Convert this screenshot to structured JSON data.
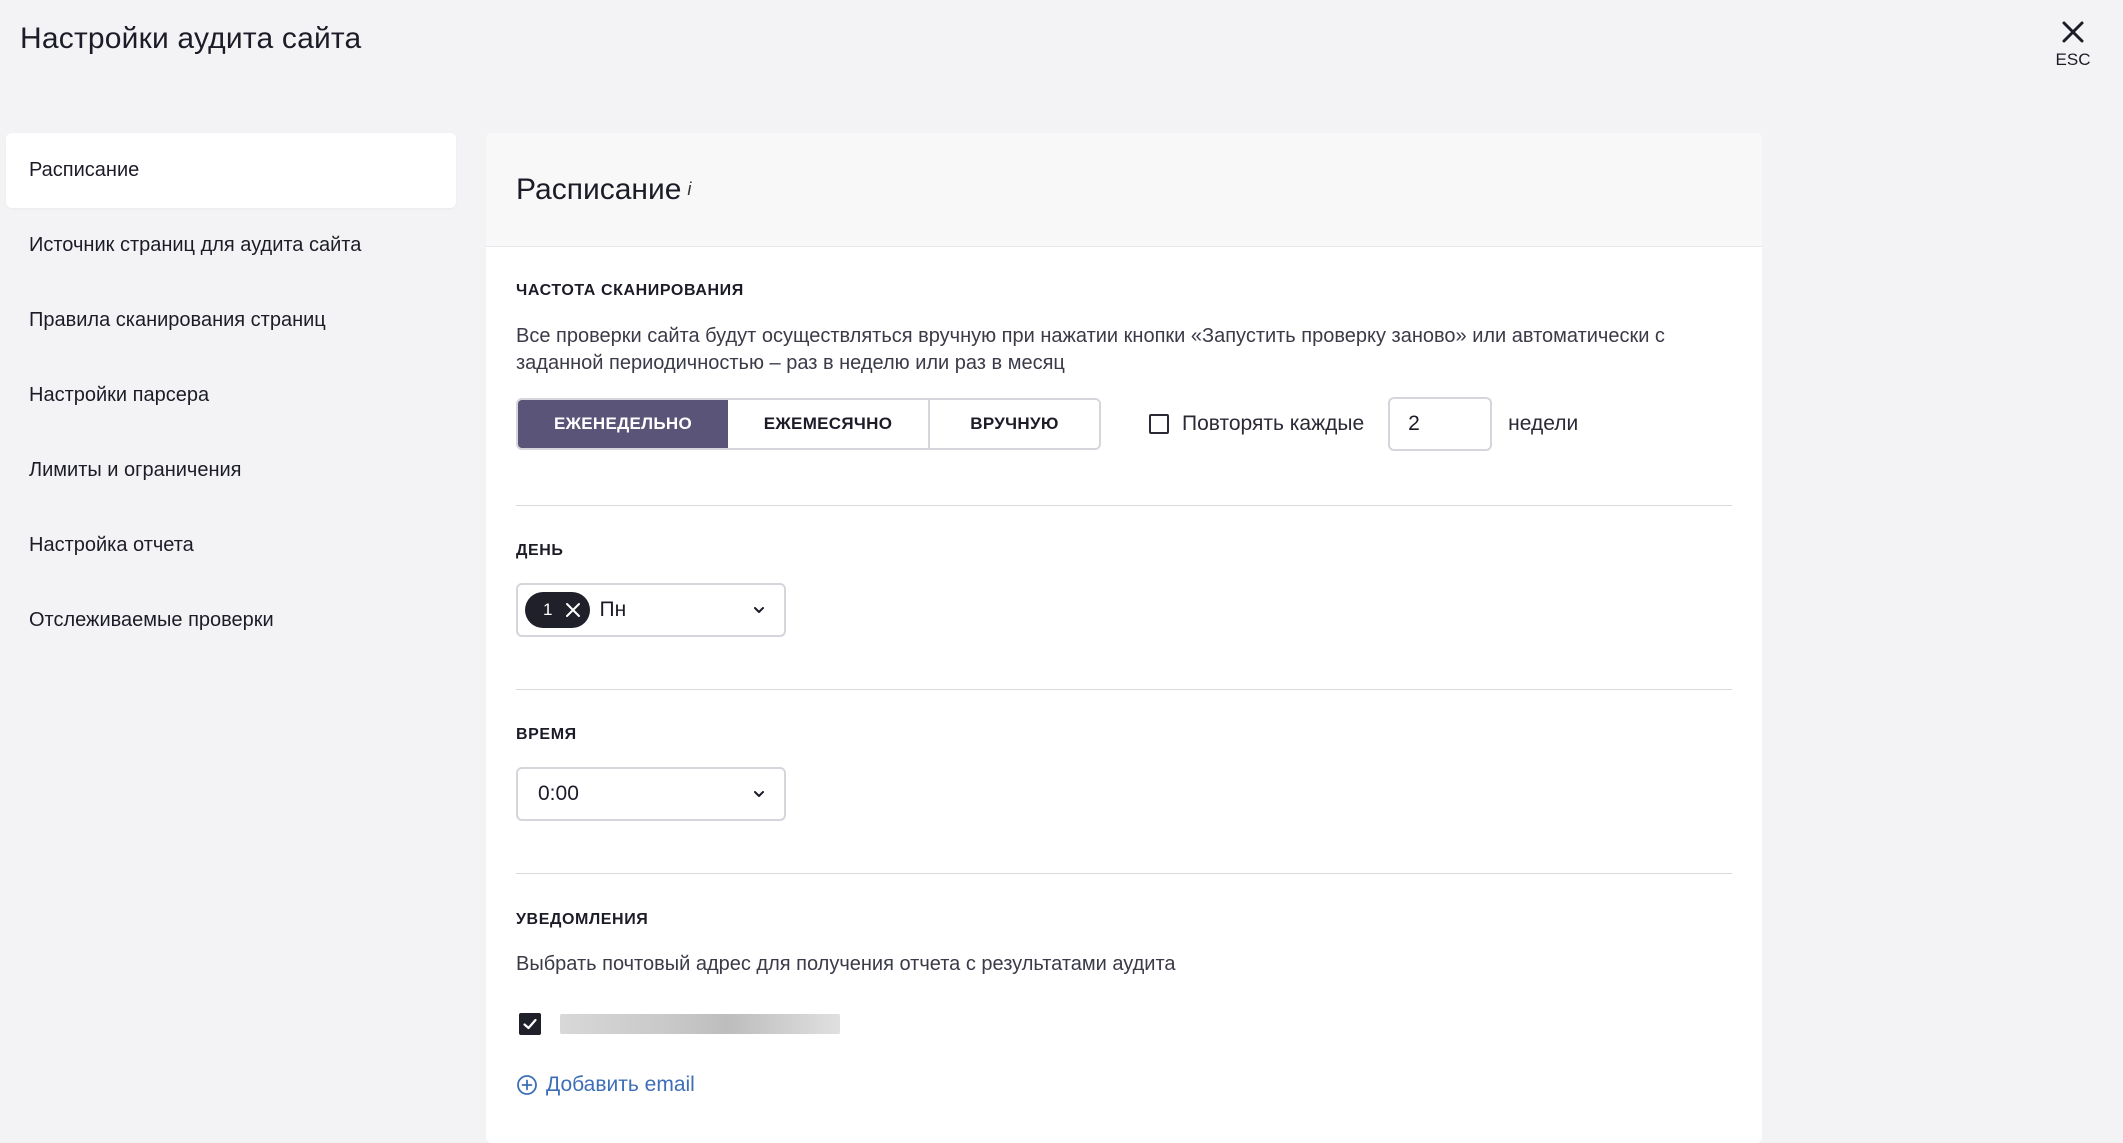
{
  "header": {
    "title": "Настройки аудита сайта",
    "close_label": "ESC"
  },
  "sidebar": {
    "items": [
      {
        "label": "Расписание",
        "active": true
      },
      {
        "label": "Источник страниц для аудита сайта"
      },
      {
        "label": "Правила сканирования страниц"
      },
      {
        "label": "Настройки парсера"
      },
      {
        "label": "Лимиты и ограничения"
      },
      {
        "label": "Настройка отчета"
      },
      {
        "label": "Отслеживаемые проверки"
      }
    ]
  },
  "panel": {
    "title": "Расписание",
    "info_mark": "i",
    "frequency": {
      "label": "ЧАСТОТА СКАНИРОВАНИЯ",
      "description": "Все проверки сайта будут осуществляться вручную при нажатии кнопки «Запустить проверку заново» или автоматически с заданной периодичностью – раз в неделю или раз в месяц",
      "options": [
        "ЕЖЕНЕДЕЛЬНО",
        "ЕЖЕМЕСЯЧНО",
        "ВРУЧНУЮ"
      ],
      "selected": "ЕЖЕНЕДЕЛЬНО",
      "repeat_label": "Повторять каждые",
      "repeat_checked": false,
      "repeat_value": "2",
      "repeat_unit": "недели"
    },
    "day": {
      "label": "ДЕНЬ",
      "chip_count": "1",
      "value": "Пн"
    },
    "time": {
      "label": "ВРЕМЯ",
      "value": "0:00"
    },
    "notifications": {
      "label": "УВЕДОМЛЕНИЯ",
      "description": "Выбрать почтовый адрес для получения отчета с результатами аудита",
      "email_checked": true,
      "add_label": "Добавить email"
    }
  },
  "colors": {
    "accent": "#5a5478",
    "link": "#3d6fb6",
    "chip": "#1f2029"
  }
}
